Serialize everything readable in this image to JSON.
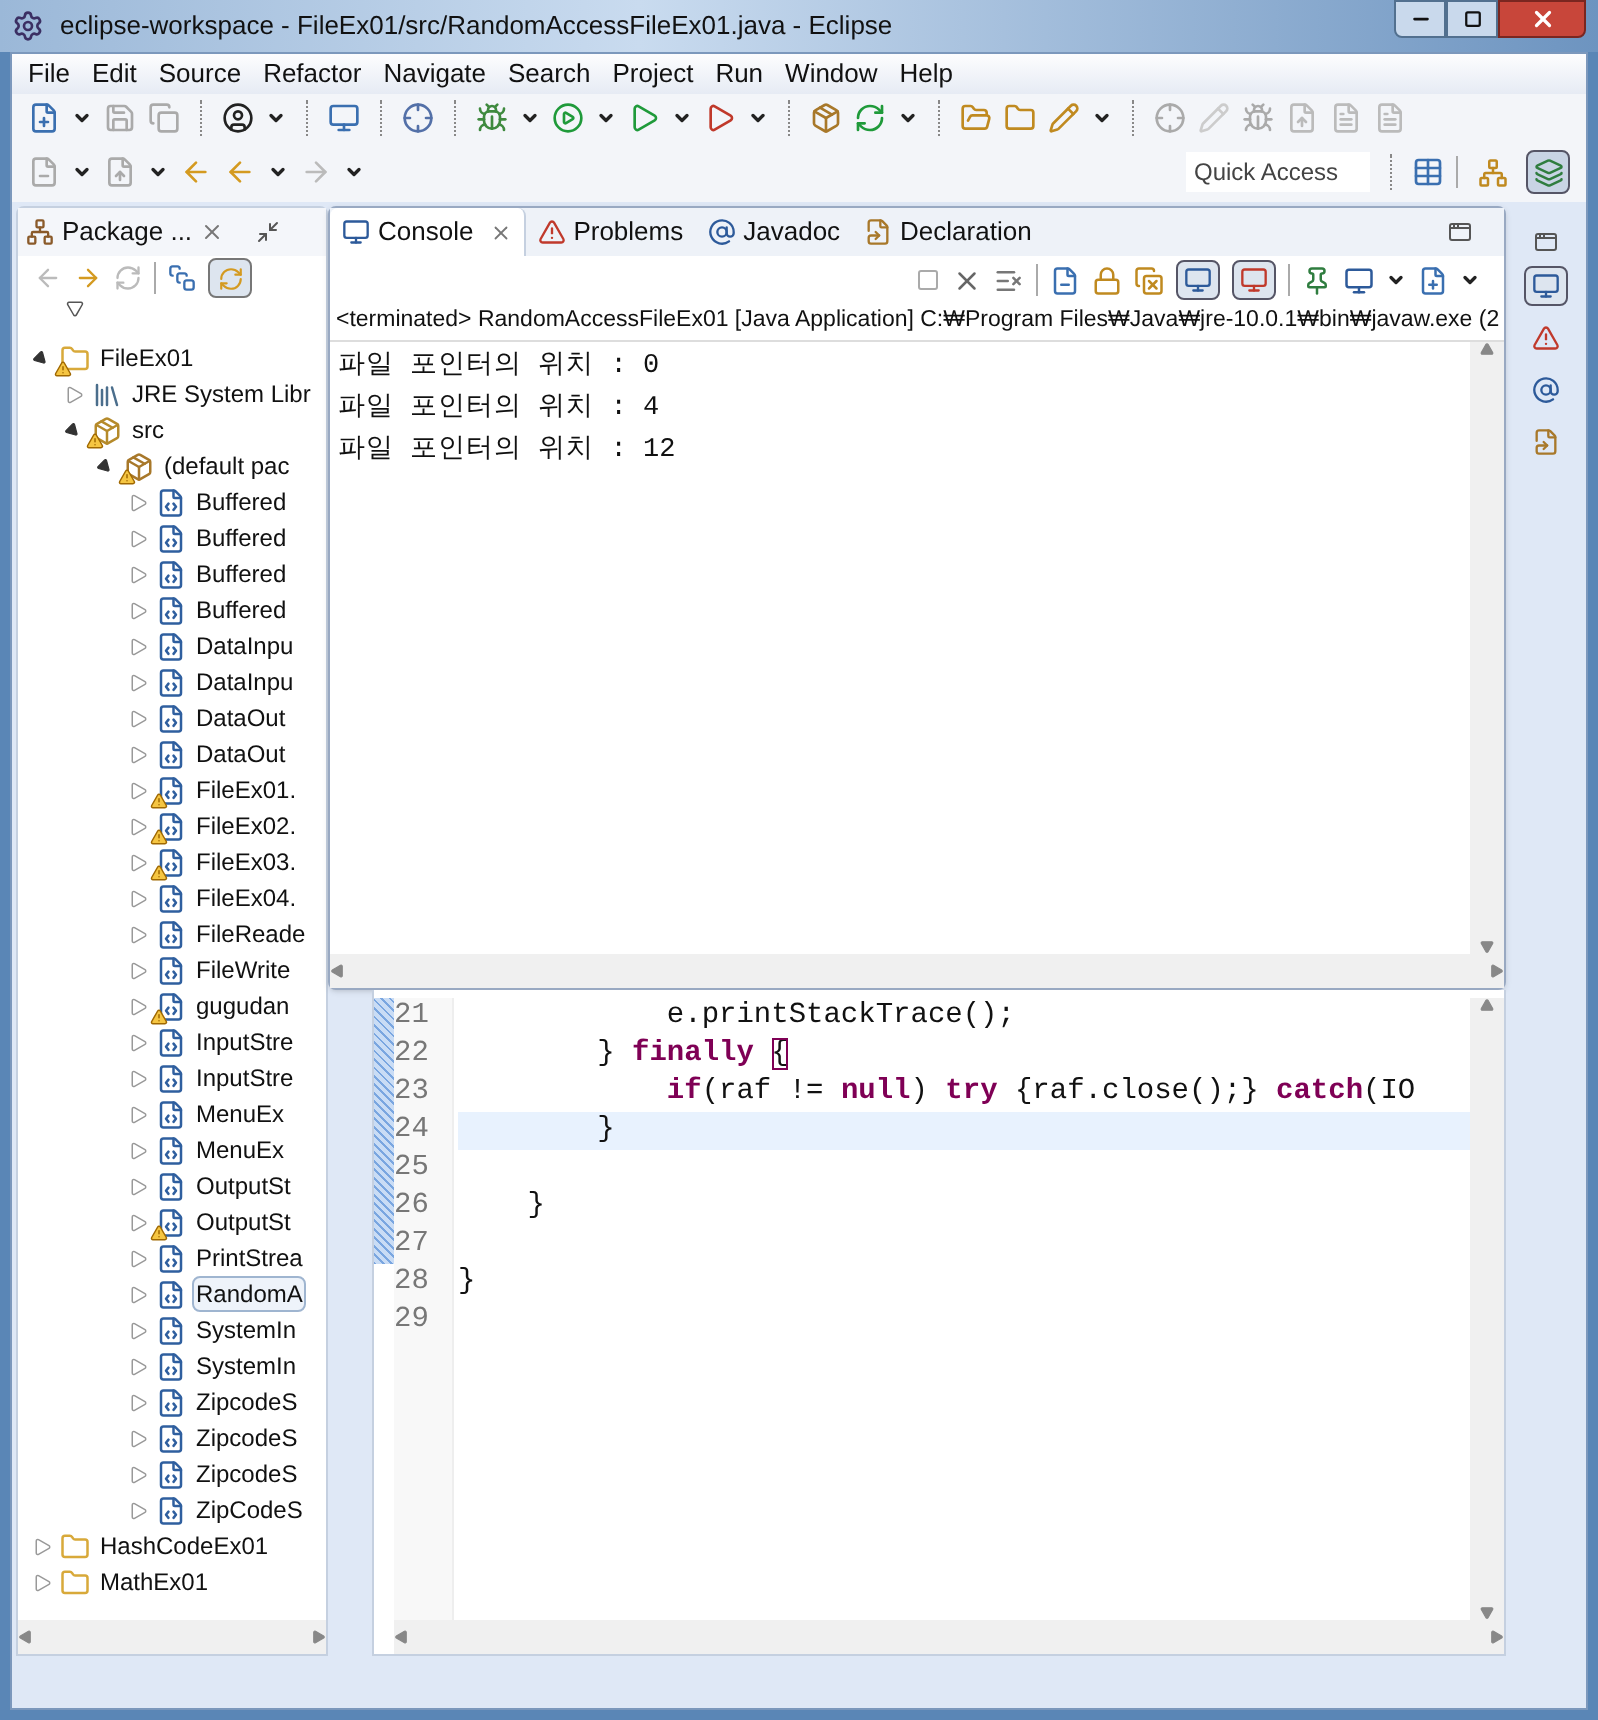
{
  "window": {
    "title": "eclipse-workspace - FileEx01/src/RandomAccessFileEx01.java - Eclipse"
  },
  "menu": [
    "File",
    "Edit",
    "Source",
    "Refactor",
    "Navigate",
    "Search",
    "Project",
    "Run",
    "Window",
    "Help"
  ],
  "quick_access": {
    "placeholder": "Quick Access"
  },
  "perspectives": [
    {
      "kind": "hierarchy",
      "selected": false
    },
    {
      "kind": "java",
      "selected": true
    }
  ],
  "package_explorer": {
    "tab": {
      "label": "Package ...",
      "selected": true
    },
    "link_with_editor": {
      "on": true
    },
    "tree": [
      {
        "label": "FileEx01",
        "kind": "project",
        "expanded": true,
        "warning": true,
        "selected": false,
        "children": [
          {
            "label": "JRE System Libr",
            "kind": "library",
            "expanded": false,
            "warning": false,
            "selected": false
          },
          {
            "label": "src",
            "kind": "source",
            "expanded": true,
            "warning": true,
            "selected": false,
            "children": [
              {
                "label": "(default pac",
                "kind": "package",
                "expanded": true,
                "warning": true,
                "selected": false,
                "children": [
                  {
                    "label": "Buffered",
                    "kind": "file",
                    "expanded": false,
                    "warning": false,
                    "selected": false
                  },
                  {
                    "label": "Buffered",
                    "kind": "file",
                    "expanded": false,
                    "warning": false,
                    "selected": false
                  },
                  {
                    "label": "Buffered",
                    "kind": "file",
                    "expanded": false,
                    "warning": false,
                    "selected": false
                  },
                  {
                    "label": "Buffered",
                    "kind": "file",
                    "expanded": false,
                    "warning": false,
                    "selected": false
                  },
                  {
                    "label": "DataInpu",
                    "kind": "file",
                    "expanded": false,
                    "warning": false,
                    "selected": false
                  },
                  {
                    "label": "DataInpu",
                    "kind": "file",
                    "expanded": false,
                    "warning": false,
                    "selected": false
                  },
                  {
                    "label": "DataOut",
                    "kind": "file",
                    "expanded": false,
                    "warning": false,
                    "selected": false
                  },
                  {
                    "label": "DataOut",
                    "kind": "file",
                    "expanded": false,
                    "warning": false,
                    "selected": false
                  },
                  {
                    "label": "FileEx01.",
                    "kind": "file",
                    "expanded": false,
                    "warning": true,
                    "selected": false
                  },
                  {
                    "label": "FileEx02.",
                    "kind": "file",
                    "expanded": false,
                    "warning": true,
                    "selected": false
                  },
                  {
                    "label": "FileEx03.",
                    "kind": "file",
                    "expanded": false,
                    "warning": true,
                    "selected": false
                  },
                  {
                    "label": "FileEx04.",
                    "kind": "file",
                    "expanded": false,
                    "warning": false,
                    "selected": false
                  },
                  {
                    "label": "FileReade",
                    "kind": "file",
                    "expanded": false,
                    "warning": false,
                    "selected": false
                  },
                  {
                    "label": "FileWrite",
                    "kind": "file",
                    "expanded": false,
                    "warning": false,
                    "selected": false
                  },
                  {
                    "label": "gugudan",
                    "kind": "file",
                    "expanded": false,
                    "warning": true,
                    "selected": false
                  },
                  {
                    "label": "InputStre",
                    "kind": "file",
                    "expanded": false,
                    "warning": false,
                    "selected": false
                  },
                  {
                    "label": "InputStre",
                    "kind": "file",
                    "expanded": false,
                    "warning": false,
                    "selected": false
                  },
                  {
                    "label": "MenuEx",
                    "kind": "file",
                    "expanded": false,
                    "warning": false,
                    "selected": false
                  },
                  {
                    "label": "MenuEx",
                    "kind": "file",
                    "expanded": false,
                    "warning": false,
                    "selected": false
                  },
                  {
                    "label": "OutputSt",
                    "kind": "file",
                    "expanded": false,
                    "warning": false,
                    "selected": false
                  },
                  {
                    "label": "OutputSt",
                    "kind": "file",
                    "expanded": false,
                    "warning": true,
                    "selected": false
                  },
                  {
                    "label": "PrintStrea",
                    "kind": "file",
                    "expanded": false,
                    "warning": false,
                    "selected": false
                  },
                  {
                    "label": "RandomA",
                    "kind": "file",
                    "expanded": false,
                    "warning": false,
                    "selected": true
                  },
                  {
                    "label": "SystemIn",
                    "kind": "file",
                    "expanded": false,
                    "warning": false,
                    "selected": false
                  },
                  {
                    "label": "SystemIn",
                    "kind": "file",
                    "expanded": false,
                    "warning": false,
                    "selected": false
                  },
                  {
                    "label": "ZipcodeS",
                    "kind": "file",
                    "expanded": false,
                    "warning": false,
                    "selected": false
                  },
                  {
                    "label": "ZipcodeS",
                    "kind": "file",
                    "expanded": false,
                    "warning": false,
                    "selected": false
                  },
                  {
                    "label": "ZipcodeS",
                    "kind": "file",
                    "expanded": false,
                    "warning": false,
                    "selected": false
                  },
                  {
                    "label": "ZipCodeS",
                    "kind": "file",
                    "expanded": false,
                    "warning": false,
                    "selected": false
                  }
                ]
              }
            ]
          }
        ]
      },
      {
        "label": "HashCodeEx01",
        "kind": "project",
        "expanded": false,
        "warning": false,
        "selected": false
      },
      {
        "label": "MathEx01",
        "kind": "project",
        "expanded": false,
        "warning": false,
        "selected": false
      }
    ]
  },
  "console": {
    "tabs": [
      {
        "label": "Console",
        "kind": "console",
        "selected": true
      },
      {
        "label": "Problems",
        "kind": "problems",
        "selected": false
      },
      {
        "label": "Javadoc",
        "kind": "javadoc",
        "selected": false
      },
      {
        "label": "Declaration",
        "kind": "declaration",
        "selected": false
      }
    ],
    "toggles": [
      {
        "kind": "stdout",
        "on": true
      },
      {
        "kind": "stderr",
        "on": true
      }
    ],
    "header": "<terminated> RandomAccessFileEx01 [Java Application] C:₩Program Files₩Java₩jre-10.0.1₩bin₩javaw.exe (2",
    "lines": [
      "파일 포인터의 위치 : 0",
      "파일 포인터의 위치 : 4",
      "파일 포인터의 위치 : 12"
    ]
  },
  "editor": {
    "lines": [
      {
        "number": "21",
        "current": false,
        "segments": [
          {
            "text": "            e.printStackTrace();",
            "kind": "plain"
          }
        ]
      },
      {
        "number": "22",
        "current": false,
        "segments": [
          {
            "text": "        } ",
            "kind": "plain"
          },
          {
            "text": "finally ",
            "kind": "keyword"
          },
          {
            "text": "{",
            "kind": "bracket"
          }
        ]
      },
      {
        "number": "23",
        "current": false,
        "segments": [
          {
            "text": "            if",
            "kind": "keyword"
          },
          {
            "text": "(raf != ",
            "kind": "plain"
          },
          {
            "text": "null",
            "kind": "keyword"
          },
          {
            "text": ") ",
            "kind": "plain"
          },
          {
            "text": "try",
            "kind": "keyword"
          },
          {
            "text": " {raf.close();} ",
            "kind": "plain"
          },
          {
            "text": "catch",
            "kind": "keyword"
          },
          {
            "text": "(IO",
            "kind": "plain"
          }
        ]
      },
      {
        "number": "24",
        "current": true,
        "segments": [
          {
            "text": "        }",
            "kind": "plain"
          }
        ]
      },
      {
        "number": "25",
        "current": false
      },
      {
        "number": "26",
        "current": false,
        "segments": [
          {
            "text": "    }",
            "kind": "plain"
          }
        ]
      },
      {
        "number": "27",
        "current": false
      },
      {
        "number": "28",
        "current": false,
        "segments": [
          {
            "text": "}",
            "kind": "plain"
          }
        ]
      },
      {
        "number": "29",
        "current": false
      }
    ]
  },
  "trim": [
    {
      "kind": "console",
      "selected": true
    },
    {
      "kind": "problems",
      "selected": false
    },
    {
      "kind": "javadoc",
      "selected": false
    },
    {
      "kind": "declaration",
      "selected": false
    }
  ]
}
